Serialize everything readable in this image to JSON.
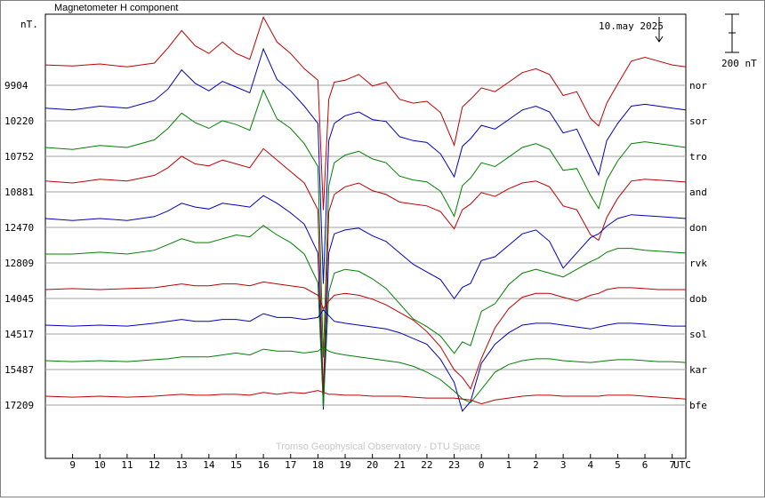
{
  "chart_data": {
    "type": "line",
    "title": "Magnetometer H component",
    "unit_label": "nT.",
    "date_label": "10.may 2025",
    "scale_bar_label": "200 nT",
    "footer": "Tromso Geophysical Observatory - DTU Space",
    "x_unit": "UTC",
    "x_ticks": [
      "9",
      "10",
      "11",
      "12",
      "13",
      "14",
      "15",
      "16",
      "17",
      "18",
      "19",
      "20",
      "21",
      "22",
      "23",
      "0",
      "1",
      "2",
      "3",
      "4",
      "5",
      "6",
      "7"
    ],
    "x_range_hours": [
      8,
      31.5
    ],
    "stations": [
      {
        "name": "nor",
        "baseline": "9904",
        "color": "#c00000",
        "x": [
          8,
          9,
          10,
          11,
          12,
          12.5,
          13,
          13.5,
          14,
          14.5,
          15,
          15.5,
          16,
          16.5,
          17,
          17.5,
          18,
          18.2,
          18.4,
          18.6,
          19,
          19.5,
          20,
          20.5,
          21,
          21.5,
          22,
          22.5,
          23,
          23.3,
          23.6,
          24,
          24.5,
          25,
          25.5,
          26,
          26.5,
          27,
          27.5,
          28,
          28.3,
          28.6,
          29,
          29.5,
          30,
          30.5,
          31,
          31.5
        ],
        "y": [
          60,
          55,
          65,
          50,
          70,
          150,
          240,
          160,
          120,
          180,
          120,
          90,
          310,
          180,
          120,
          40,
          -20,
          -700,
          -120,
          -30,
          -20,
          10,
          -50,
          -30,
          -120,
          -140,
          -130,
          -190,
          -360,
          -160,
          -120,
          -60,
          -80,
          -30,
          20,
          40,
          10,
          -100,
          -80,
          -220,
          -260,
          -140,
          -40,
          80,
          100,
          80,
          60,
          50
        ]
      },
      {
        "name": "sor",
        "baseline": "10220",
        "color": "#0000c0",
        "x": [
          8,
          9,
          10,
          11,
          12,
          12.5,
          13,
          13.5,
          14,
          14.5,
          15,
          15.5,
          16,
          16.5,
          17,
          17.5,
          18,
          18.2,
          18.4,
          18.6,
          19,
          19.5,
          20,
          20.5,
          21,
          21.5,
          22,
          22.5,
          23,
          23.3,
          23.6,
          24,
          24.5,
          25,
          25.5,
          26,
          26.5,
          27,
          27.5,
          28,
          28.3,
          28.6,
          29,
          29.5,
          30,
          30.5,
          31,
          31.5
        ],
        "y": [
          20,
          10,
          30,
          20,
          60,
          120,
          220,
          150,
          110,
          160,
          130,
          100,
          330,
          170,
          110,
          30,
          -60,
          -900,
          -150,
          -60,
          -20,
          0,
          -40,
          -50,
          -130,
          -150,
          -160,
          -220,
          -340,
          -180,
          -140,
          -70,
          -90,
          -40,
          10,
          30,
          0,
          -110,
          -90,
          -240,
          -330,
          -150,
          -60,
          30,
          40,
          30,
          20,
          10
        ]
      },
      {
        "name": "tro",
        "baseline": "10752",
        "color": "#008000",
        "x": [
          8,
          9,
          10,
          11,
          12,
          12.5,
          13,
          13.5,
          14,
          14.5,
          15,
          15.5,
          16,
          16.5,
          17,
          17.5,
          18,
          18.2,
          18.4,
          18.6,
          19,
          19.5,
          20,
          20.5,
          21,
          21.5,
          22,
          22.5,
          23,
          23.3,
          23.6,
          24,
          24.5,
          25,
          25.5,
          26,
          26.5,
          27,
          27.5,
          28,
          28.3,
          28.6,
          29,
          29.5,
          30,
          30.5,
          31,
          31.5
        ],
        "y": [
          0,
          -10,
          10,
          0,
          40,
          100,
          180,
          130,
          100,
          140,
          120,
          90,
          300,
          150,
          100,
          20,
          -100,
          -1100,
          -200,
          -80,
          -40,
          -20,
          -60,
          -80,
          -150,
          -170,
          -180,
          -230,
          -360,
          -200,
          -160,
          -80,
          -100,
          -50,
          0,
          20,
          -10,
          -120,
          -110,
          -250,
          -320,
          -170,
          -70,
          20,
          30,
          20,
          10,
          0
        ]
      },
      {
        "name": "and",
        "baseline": "10881",
        "color": "#c00000",
        "x": [
          8,
          9,
          10,
          11,
          12,
          12.5,
          13,
          13.5,
          14,
          14.5,
          15,
          15.5,
          16,
          16.5,
          17,
          17.5,
          18,
          18.2,
          18.4,
          18.6,
          19,
          19.5,
          20,
          20.5,
          21,
          21.5,
          22,
          22.5,
          23,
          23.3,
          23.6,
          24,
          24.5,
          25,
          25.5,
          26,
          26.5,
          27,
          27.5,
          28,
          28.3,
          28.6,
          29,
          29.5,
          30,
          30.5,
          31,
          31.5
        ],
        "y": [
          10,
          0,
          20,
          10,
          40,
          80,
          140,
          100,
          90,
          120,
          100,
          80,
          180,
          120,
          60,
          0,
          -140,
          -1100,
          -150,
          -60,
          -20,
          0,
          -40,
          -60,
          -100,
          -110,
          -120,
          -150,
          -240,
          -140,
          -110,
          -50,
          -70,
          -30,
          0,
          10,
          -20,
          -120,
          -140,
          -270,
          -300,
          -180,
          -80,
          10,
          20,
          15,
          10,
          5
        ]
      },
      {
        "name": "don",
        "baseline": "12470",
        "color": "#0000c0",
        "x": [
          8,
          9,
          10,
          11,
          12,
          12.5,
          13,
          13.5,
          14,
          14.5,
          15,
          15.5,
          16,
          16.5,
          17,
          17.5,
          18,
          18.2,
          18.4,
          18.6,
          19,
          19.5,
          20,
          20.5,
          21,
          21.5,
          22,
          22.5,
          23,
          23.3,
          23.6,
          24,
          24.5,
          25,
          25.5,
          26,
          26.5,
          27,
          27.5,
          28,
          28.3,
          28.6,
          29,
          29.5,
          30,
          30.5,
          31,
          31.5
        ],
        "y": [
          0,
          -10,
          0,
          -10,
          10,
          40,
          80,
          60,
          50,
          80,
          70,
          60,
          120,
          80,
          30,
          -30,
          -180,
          -1000,
          -180,
          -80,
          -60,
          -50,
          -90,
          -120,
          -180,
          -240,
          -280,
          -320,
          -420,
          -360,
          -340,
          -220,
          -200,
          -140,
          -80,
          -60,
          -120,
          -260,
          -180,
          -100,
          -80,
          -40,
          0,
          20,
          15,
          10,
          5,
          0
        ]
      },
      {
        "name": "rvk",
        "baseline": "12809",
        "color": "#008000",
        "x": [
          8,
          9,
          10,
          11,
          12,
          12.5,
          13,
          13.5,
          14,
          14.5,
          15,
          15.5,
          16,
          16.5,
          17,
          17.5,
          18,
          18.2,
          18.4,
          18.6,
          19,
          19.5,
          20,
          20.5,
          21,
          21.5,
          22,
          22.5,
          23,
          23.3,
          23.6,
          24,
          24.5,
          25,
          25.5,
          26,
          26.5,
          27,
          27.5,
          28,
          28.3,
          28.6,
          29,
          29.5,
          30,
          30.5,
          31,
          31.5
        ],
        "y": [
          0,
          0,
          10,
          0,
          20,
          50,
          80,
          60,
          60,
          80,
          100,
          90,
          150,
          100,
          60,
          0,
          -150,
          -800,
          -200,
          -100,
          -80,
          -90,
          -130,
          -180,
          -260,
          -340,
          -380,
          -430,
          -520,
          -460,
          -480,
          -300,
          -260,
          -160,
          -100,
          -80,
          -100,
          -120,
          -80,
          -40,
          -20,
          10,
          30,
          30,
          20,
          15,
          10,
          5
        ]
      },
      {
        "name": "dob",
        "baseline": "14045",
        "color": "#c00000",
        "x": [
          8,
          9,
          10,
          11,
          12,
          12.5,
          13,
          13.5,
          14,
          14.5,
          15,
          15.5,
          16,
          16.5,
          17,
          17.5,
          18,
          18.2,
          18.4,
          18.6,
          19,
          19.5,
          20,
          20.5,
          21,
          21.5,
          22,
          22.5,
          23,
          23.3,
          23.6,
          24,
          24.5,
          25,
          25.5,
          26,
          26.5,
          27,
          27.5,
          28,
          28.3,
          28.6,
          29,
          29.5,
          30,
          30.5,
          31,
          31.5
        ],
        "y": [
          0,
          5,
          0,
          5,
          10,
          20,
          30,
          20,
          20,
          30,
          30,
          20,
          40,
          30,
          20,
          10,
          -30,
          -100,
          -60,
          -30,
          -20,
          -30,
          -50,
          -80,
          -120,
          -160,
          -220,
          -300,
          -420,
          -460,
          -520,
          -360,
          -200,
          -100,
          -40,
          -20,
          -20,
          -40,
          -60,
          -30,
          -20,
          0,
          10,
          10,
          5,
          0,
          0,
          0
        ]
      },
      {
        "name": "sol",
        "baseline": "14517",
        "color": "#0000c0",
        "x": [
          8,
          9,
          10,
          11,
          12,
          12.5,
          13,
          13.5,
          14,
          14.5,
          15,
          15.5,
          16,
          16.5,
          17,
          17.5,
          18,
          18.2,
          18.4,
          18.6,
          19,
          19.5,
          20,
          20.5,
          21,
          21.5,
          22,
          22.5,
          23,
          23.3,
          23.6,
          24,
          24.5,
          25,
          25.5,
          26,
          26.5,
          27,
          27.5,
          28,
          28.3,
          28.6,
          29,
          29.5,
          30,
          30.5,
          31,
          31.5
        ],
        "y": [
          0,
          -5,
          0,
          -5,
          10,
          20,
          30,
          20,
          20,
          30,
          30,
          20,
          60,
          40,
          40,
          30,
          40,
          80,
          50,
          20,
          10,
          0,
          -10,
          -20,
          -40,
          -70,
          -100,
          -180,
          -300,
          -450,
          -400,
          -200,
          -100,
          -40,
          0,
          10,
          10,
          0,
          -10,
          -20,
          -10,
          0,
          10,
          10,
          5,
          0,
          -5,
          -5
        ]
      },
      {
        "name": "kar",
        "baseline": "15487",
        "color": "#008000",
        "x": [
          8,
          9,
          10,
          11,
          12,
          12.5,
          13,
          13.5,
          14,
          14.5,
          15,
          15.5,
          16,
          16.5,
          17,
          17.5,
          18,
          18.2,
          18.4,
          18.6,
          19,
          19.5,
          20,
          20.5,
          21,
          21.5,
          22,
          22.5,
          23,
          23.3,
          23.6,
          24,
          24.5,
          25,
          25.5,
          26,
          26.5,
          27,
          27.5,
          28,
          28.3,
          28.6,
          29,
          29.5,
          30,
          30.5,
          31,
          31.5
        ],
        "y": [
          0,
          -5,
          0,
          -5,
          5,
          10,
          20,
          20,
          20,
          30,
          40,
          30,
          60,
          50,
          50,
          40,
          50,
          70,
          50,
          40,
          30,
          20,
          10,
          0,
          -10,
          -30,
          -60,
          -100,
          -160,
          -200,
          -220,
          -150,
          -60,
          -20,
          0,
          10,
          10,
          0,
          -5,
          -10,
          -5,
          0,
          5,
          5,
          0,
          -5,
          -5,
          -10
        ]
      },
      {
        "name": "bfe",
        "baseline": "17209",
        "color": "#c00000",
        "x": [
          8,
          9,
          10,
          11,
          12,
          12.5,
          13,
          13.5,
          14,
          14.5,
          15,
          15.5,
          16,
          16.5,
          17,
          17.5,
          18,
          18.2,
          18.4,
          18.6,
          19,
          19.5,
          20,
          20.5,
          21,
          21.5,
          22,
          22.5,
          23,
          23.3,
          23.6,
          24,
          24.5,
          25,
          25.5,
          26,
          26.5,
          27,
          27.5,
          28,
          28.3,
          28.6,
          29,
          29.5,
          30,
          30.5,
          31,
          31.5
        ],
        "y": [
          0,
          -5,
          0,
          -5,
          0,
          5,
          10,
          5,
          5,
          10,
          10,
          5,
          20,
          10,
          20,
          15,
          30,
          20,
          10,
          10,
          5,
          5,
          0,
          0,
          0,
          -5,
          -10,
          -10,
          -10,
          -15,
          -20,
          -40,
          -20,
          -10,
          0,
          5,
          5,
          0,
          0,
          0,
          0,
          5,
          5,
          5,
          0,
          -5,
          -10,
          -15
        ]
      }
    ]
  }
}
